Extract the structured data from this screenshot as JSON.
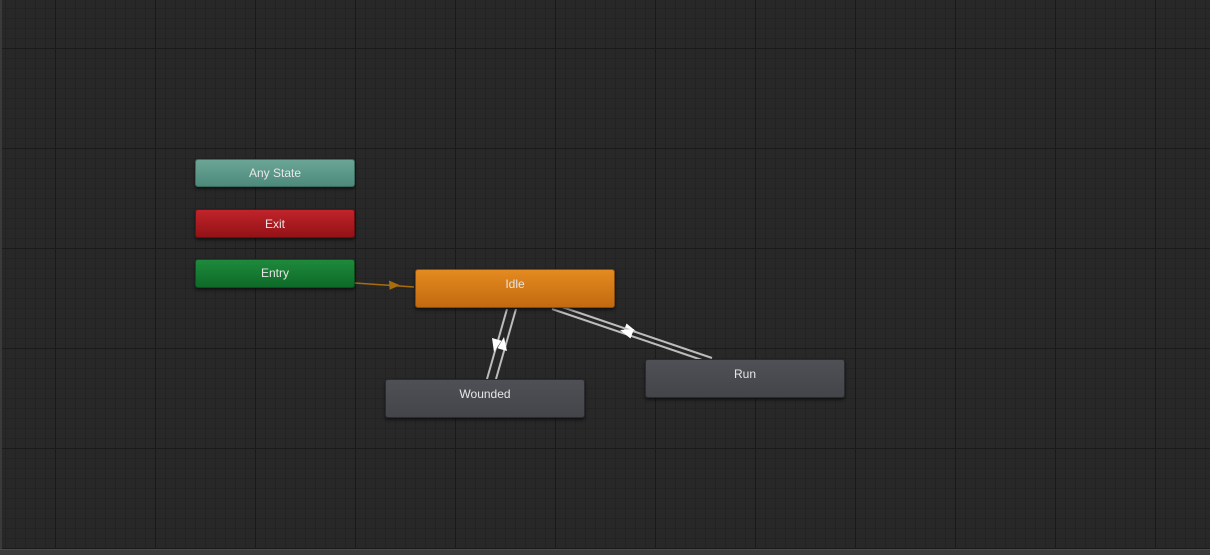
{
  "graph": {
    "nodes": {
      "any_state": {
        "label": "Any State",
        "color": "#5c9a8b"
      },
      "exit": {
        "label": "Exit",
        "color": "#a8181e"
      },
      "entry": {
        "label": "Entry",
        "color": "#137a32"
      },
      "idle": {
        "label": "Idle",
        "color": "#d57a18"
      },
      "wounded": {
        "label": "Wounded",
        "color": "#48494e"
      },
      "run": {
        "label": "Run",
        "color": "#48494e"
      }
    },
    "transitions": [
      {
        "from": "entry",
        "to": "idle",
        "color": "#a86d0c"
      },
      {
        "from": "idle",
        "to": "wounded",
        "color": "#c8c8c8"
      },
      {
        "from": "wounded",
        "to": "idle",
        "color": "#c8c8c8"
      },
      {
        "from": "idle",
        "to": "run",
        "color": "#c8c8c8"
      },
      {
        "from": "run",
        "to": "idle",
        "color": "#c8c8c8"
      }
    ]
  }
}
